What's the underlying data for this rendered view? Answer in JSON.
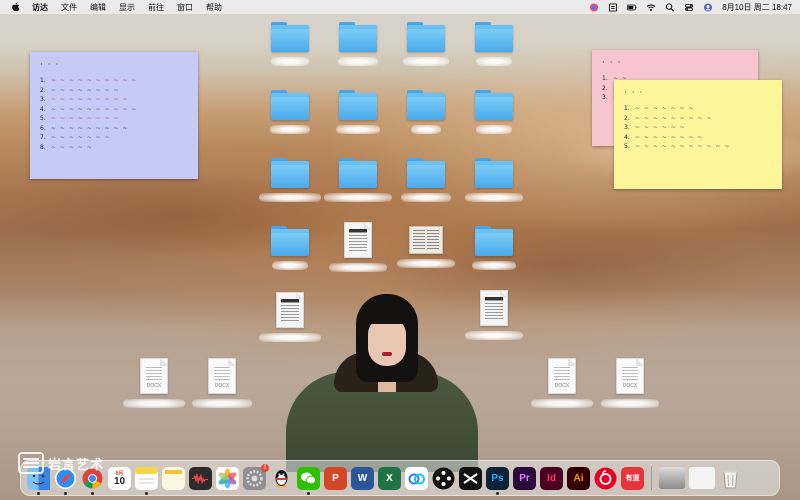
{
  "menubar": {
    "app_name": "访达",
    "menus": [
      "文件",
      "编辑",
      "显示",
      "前往",
      "窗口",
      "帮助"
    ],
    "status_icons": [
      "siri-icon",
      "input-method-icon",
      "battery-icon",
      "wifi-icon",
      "search-icon",
      "control-center-icon",
      "user-icon"
    ],
    "clock": "8月10日 周二  18:47"
  },
  "stickies": {
    "blue": {
      "title": "·  ·  ·",
      "items": [
        "1.",
        "2.",
        "3.",
        "4.",
        "5.",
        "6.",
        "7.",
        "8."
      ]
    },
    "pink": {
      "title": "· ·  ·",
      "items": [
        "1.",
        "2.",
        "3."
      ]
    },
    "yellow": {
      "title": "· · ·",
      "items": [
        "1.",
        "2.",
        "3.",
        "4.",
        "5."
      ]
    }
  },
  "desktop": {
    "icons": [
      {
        "kind": "folder"
      },
      {
        "kind": "folder"
      },
      {
        "kind": "folder"
      },
      {
        "kind": "folder"
      },
      {
        "kind": "folder"
      },
      {
        "kind": "folder"
      },
      {
        "kind": "folder"
      },
      {
        "kind": "folder"
      },
      {
        "kind": "folder"
      },
      {
        "kind": "folder"
      },
      {
        "kind": "folder"
      },
      {
        "kind": "folder"
      },
      {
        "kind": "folder"
      },
      {
        "kind": "scan-document"
      },
      {
        "kind": "book-document"
      },
      {
        "kind": "folder"
      },
      {
        "kind": "scan-document"
      },
      {
        "kind": "scan-document"
      },
      {
        "kind": "docx",
        "ext": "DOCX"
      },
      {
        "kind": "docx",
        "ext": "DOCX"
      },
      {
        "kind": "docx",
        "ext": "DOCX"
      },
      {
        "kind": "docx",
        "ext": "DOCX"
      }
    ]
  },
  "watermark": {
    "text": "岩言艺术"
  },
  "dock": {
    "apps": [
      {
        "name": "finder",
        "label": "",
        "color": "#3a8ee6"
      },
      {
        "name": "safari",
        "label": "",
        "color": "#2f8df0"
      },
      {
        "name": "chrome",
        "label": "",
        "color": "#ffffff"
      },
      {
        "name": "calendar",
        "label": "10",
        "month": "8月",
        "color": "#ffffff"
      },
      {
        "name": "notes",
        "label": "",
        "color": "#f6d44c"
      },
      {
        "name": "memo",
        "label": "",
        "color": "#fbf6df"
      },
      {
        "name": "voice-memos",
        "label": "",
        "color": "#2b2b2b"
      },
      {
        "name": "photos",
        "label": "",
        "color": "#ffffff"
      },
      {
        "name": "system-preferences",
        "label": "",
        "color": "#8e8e93",
        "badge": "1"
      },
      {
        "name": "qq",
        "label": "",
        "color": "#ffffff"
      },
      {
        "name": "wechat",
        "label": "",
        "color": "#2dc100"
      },
      {
        "name": "powerpoint",
        "label": "P",
        "color": "#d24726"
      },
      {
        "name": "word",
        "label": "W",
        "color": "#2b579a"
      },
      {
        "name": "excel",
        "label": "X",
        "color": "#217346"
      },
      {
        "name": "baidu-netdisk",
        "label": "",
        "color": "#ffffff"
      },
      {
        "name": "dots-app",
        "label": "",
        "color": "#111111"
      },
      {
        "name": "capcut",
        "label": "",
        "color": "#111111"
      },
      {
        "name": "photoshop",
        "label": "Ps",
        "color": "#0b2238",
        "text": "#31a8ff"
      },
      {
        "name": "premiere",
        "label": "Pr",
        "color": "#2a0a3a",
        "text": "#ea77ff"
      },
      {
        "name": "indesign",
        "label": "Id",
        "color": "#49021f",
        "text": "#ff3366"
      },
      {
        "name": "illustrator",
        "label": "Ai",
        "color": "#330000",
        "text": "#ff9a00"
      },
      {
        "name": "netease-music",
        "label": "",
        "color": "#e60026"
      },
      {
        "name": "youdao",
        "label": "有道",
        "color": "#e5343a"
      }
    ],
    "trash_label": ""
  }
}
